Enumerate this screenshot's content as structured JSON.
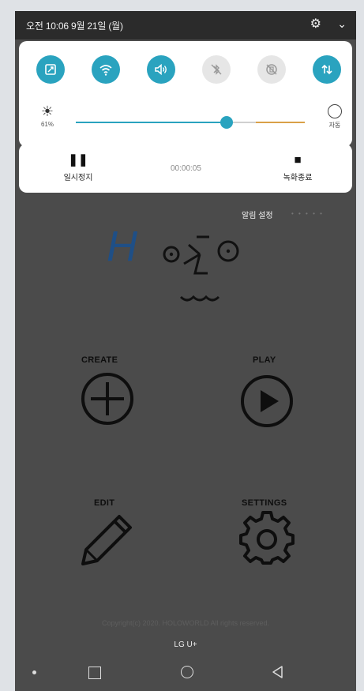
{
  "status_bar": {
    "datetime": "오전 10:06 9월 21일 (월)",
    "gear_icon": "gear-icon",
    "expand_icon": "chevron-down-icon"
  },
  "quick_settings": {
    "tiles": [
      {
        "icon": "screen-rotation-icon",
        "state": "on"
      },
      {
        "icon": "wifi-icon",
        "state": "on"
      },
      {
        "icon": "sound-icon",
        "state": "on"
      },
      {
        "icon": "bluetooth-off-icon",
        "state": "off"
      },
      {
        "icon": "auto-rotate-off-icon",
        "state": "off"
      },
      {
        "icon": "data-transfer-icon",
        "state": "on"
      }
    ],
    "brightness": {
      "percent_label": "61%",
      "level": 0.61,
      "auto_label": "자동"
    }
  },
  "recording": {
    "pause_label": "일시정지",
    "timer": "00:00:05",
    "stop_label": "녹화종료"
  },
  "notification": {
    "settings_label": "알림 설정",
    "more_dots": "• • • • •"
  },
  "logo": {
    "letter": "H"
  },
  "menu": {
    "create_label": "CREATE",
    "play_label": "PLAY",
    "edit_label": "EDIT",
    "settings_label": "SETTINGS"
  },
  "footer": {
    "copyright": "Copyright(c) 2020. HOLOWORLD All rights reserved.",
    "carrier": "LG U+"
  },
  "navigation": {
    "icons": [
      "dot-icon",
      "recent-apps-icon",
      "home-icon",
      "back-icon"
    ]
  },
  "colors": {
    "accent": "#2aa3bf",
    "background": "#4b4b4b",
    "logo_blue": "#1f4f86"
  }
}
